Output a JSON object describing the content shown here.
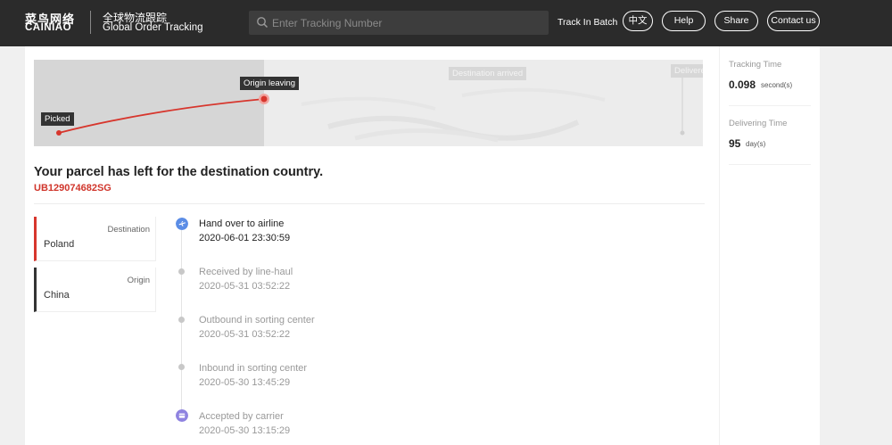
{
  "header": {
    "logo_cn": "菜鸟网络",
    "logo_en": "CAINIAO",
    "subtitle_cn": "全球物流跟踪",
    "subtitle_en": "Global Order Tracking",
    "search_placeholder": "Enter Tracking Number",
    "track_batch": "Track In Batch",
    "lang_button": "中文",
    "help_button": "Help",
    "share_button": "Share",
    "contact_button": "Contact us"
  },
  "map": {
    "picked_label": "Picked",
    "origin_label": "Origin leaving",
    "destination_label": "Destination arrived",
    "delivered_label": "Delivere"
  },
  "parcel": {
    "status_headline": "Your parcel has left for the destination country.",
    "tracking_number": "UB129074682SG"
  },
  "route": {
    "destination_label": "Destination",
    "destination_value": "Poland",
    "origin_label": "Origin",
    "origin_value": "China"
  },
  "events": [
    {
      "title": "Hand over to airline",
      "time": "2020-06-01 23:30:59",
      "icon": "airplane-icon"
    },
    {
      "title": "Received by line-haul",
      "time": "2020-05-31 03:52:22"
    },
    {
      "title": "Outbound in sorting center",
      "time": "2020-05-31 03:52:22"
    },
    {
      "title": "Inbound in sorting center",
      "time": "2020-05-30 13:45:29"
    },
    {
      "title": "Accepted by carrier",
      "time": "2020-05-30 13:15:29",
      "icon": "package-icon"
    }
  ],
  "stats": {
    "tracking_time_label": "Tracking Time",
    "tracking_time_value": "0.098",
    "tracking_time_unit": "second(s)",
    "delivering_time_label": "Delivering Time",
    "delivering_time_value": "95",
    "delivering_time_unit": "day(s)"
  },
  "colors": {
    "header_bg": "#2b2b2b",
    "accent_red": "#d0352b",
    "airline_blue": "#5b8de6",
    "carrier_purple": "#8f83e0"
  }
}
